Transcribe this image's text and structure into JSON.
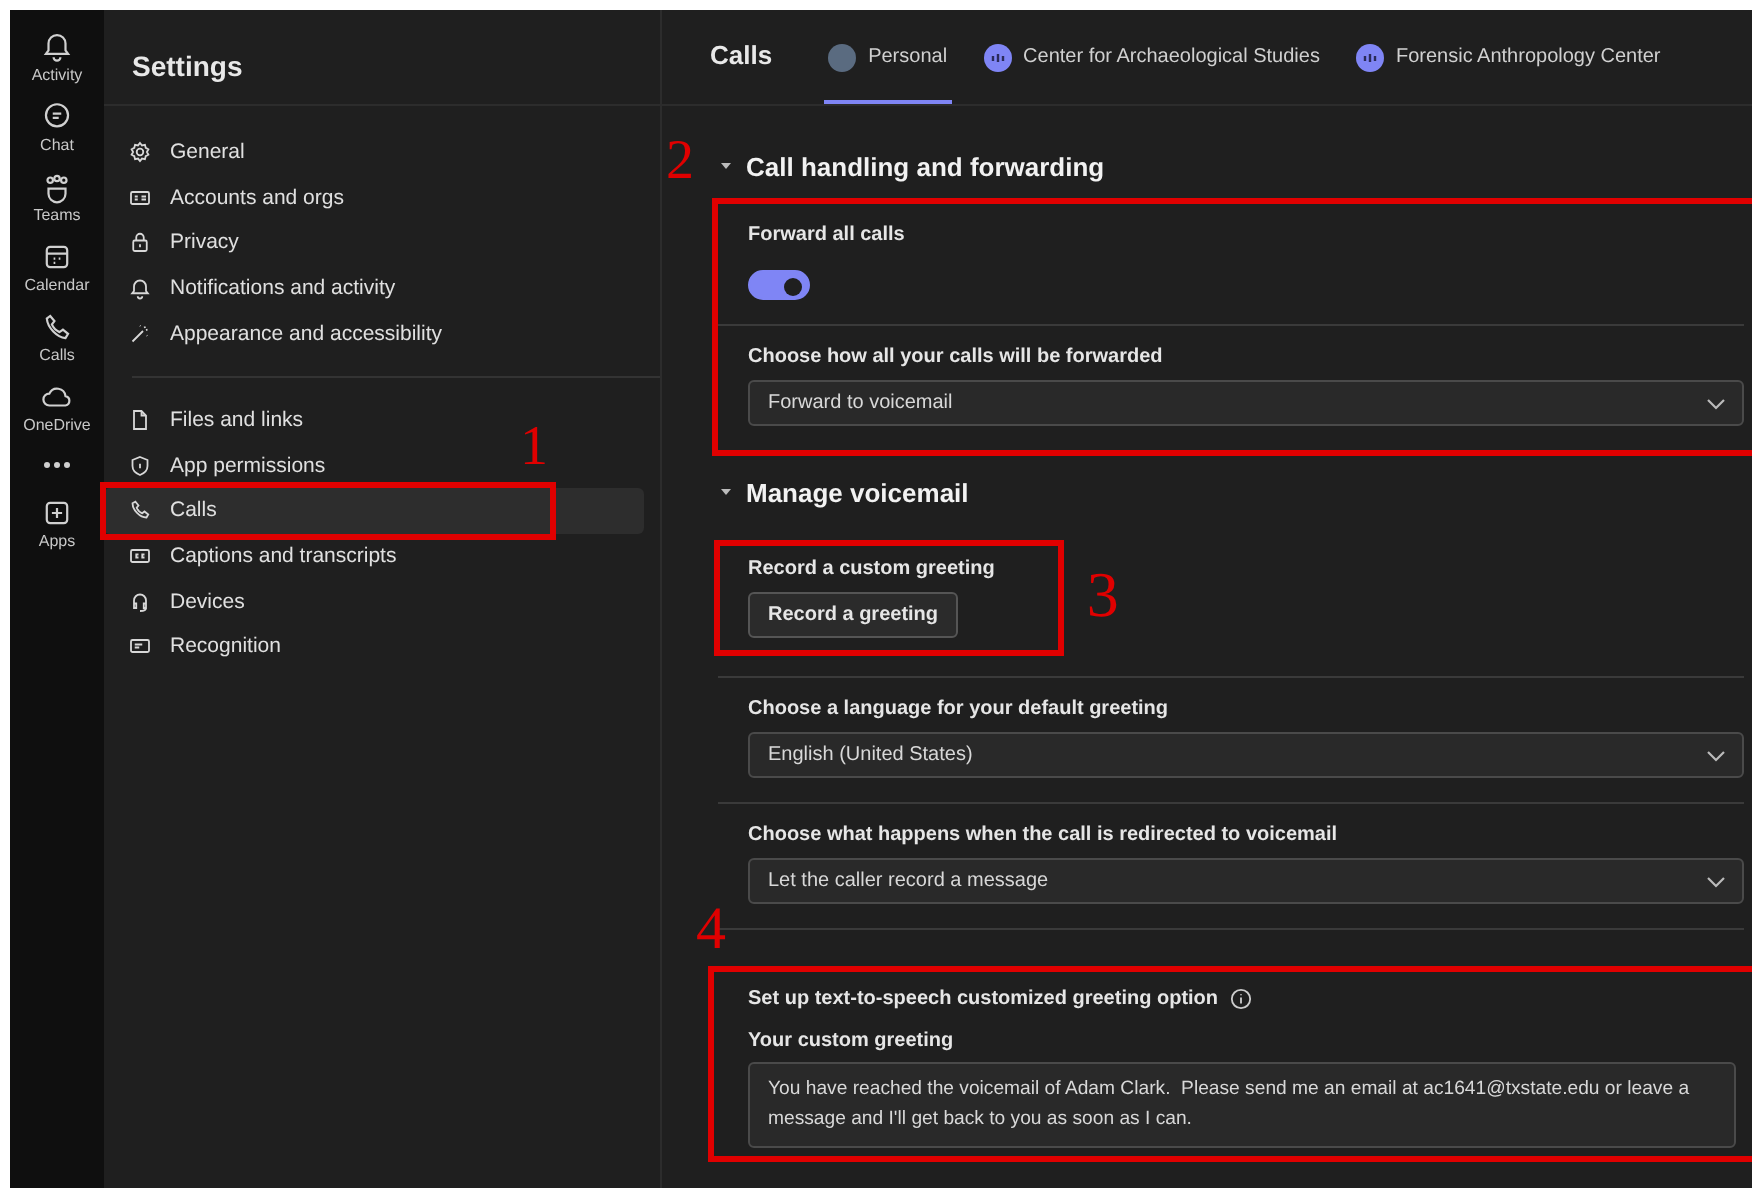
{
  "rail": [
    {
      "label": "Activity"
    },
    {
      "label": "Chat"
    },
    {
      "label": "Teams"
    },
    {
      "label": "Calendar"
    },
    {
      "label": "Calls"
    },
    {
      "label": "OneDrive"
    },
    {
      "label": "Apps"
    }
  ],
  "settings": {
    "title": "Settings",
    "annotation": "1",
    "groups": [
      [
        {
          "label": "General",
          "selected": false
        },
        {
          "label": "Accounts and orgs",
          "selected": false
        },
        {
          "label": "Privacy",
          "selected": false
        },
        {
          "label": "Notifications and activity",
          "selected": false
        },
        {
          "label": "Appearance and accessibility",
          "selected": false
        }
      ],
      [
        {
          "label": "Files and links",
          "selected": false
        },
        {
          "label": "App permissions",
          "selected": false
        },
        {
          "label": "Calls",
          "selected": true
        },
        {
          "label": "Captions and transcripts",
          "selected": false
        },
        {
          "label": "Devices",
          "selected": false
        },
        {
          "label": "Recognition",
          "selected": false
        }
      ]
    ]
  },
  "main": {
    "title": "Calls",
    "tabs": [
      {
        "label": "Personal",
        "kind": "person",
        "selected": true
      },
      {
        "label": "Center for Archaeological Studies",
        "kind": "team",
        "selected": false
      },
      {
        "label": "Forensic Anthropology Center",
        "kind": "team",
        "selected": false
      }
    ],
    "sections": [
      {
        "title": "Call handling and forwarding",
        "expanded": true,
        "annotation": "2",
        "items": [
          {
            "kind": "toggle",
            "label": "Forward all calls",
            "on": true
          },
          {
            "kind": "dropdown",
            "label": "Choose how all your calls will be forwarded",
            "value": "Forward to voicemail"
          }
        ]
      },
      {
        "title": "Manage voicemail",
        "expanded": true,
        "items": [
          {
            "kind": "button",
            "label": "Record a custom greeting",
            "button": "Record a greeting",
            "annotation": "3"
          },
          {
            "kind": "dropdown",
            "label": "Choose a language for your default greeting",
            "value": "English (United States)"
          },
          {
            "kind": "dropdown",
            "label": "Choose what happens when the call is redirected to voicemail",
            "value": "Let the caller record a message"
          },
          {
            "kind": "textarea",
            "label": "Set up text-to-speech customized greeting option",
            "sublabel": "Your custom greeting",
            "value": "You have reached the voicemail of Adam Clark.  Please send me an email at ac1641@txstate.edu or leave a message and I'll get back to you as soon as I can.",
            "annotation": "4"
          }
        ]
      }
    ]
  }
}
